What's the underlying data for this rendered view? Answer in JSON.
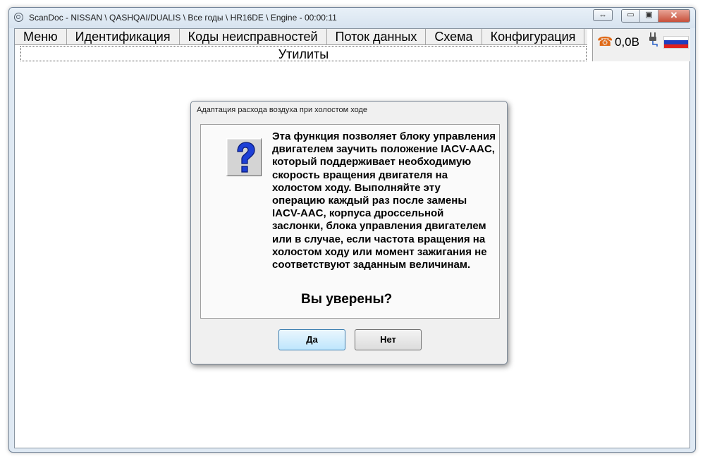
{
  "window": {
    "title": "ScanDoc - NISSAN \\ QASHQAI/DUALIS \\ Все годы \\ HR16DE \\ Engine - 00:00:11",
    "controls": {
      "swap": "⇔",
      "minimize": "▭",
      "restore": "▣",
      "close": "✕"
    }
  },
  "menu": {
    "items": [
      {
        "label": "Меню"
      },
      {
        "label": "Идентификация"
      },
      {
        "label": "Коды неисправностей"
      },
      {
        "label": "Поток данных"
      },
      {
        "label": "Схема"
      },
      {
        "label": "Конфигурация"
      }
    ],
    "utilities_label": "Утилиты"
  },
  "status": {
    "phone_glyph": "☎",
    "voltage": "0,0B",
    "phone_color": "#e06a18",
    "flag_colors": [
      "#ffffff",
      "#1f3fbf",
      "#e0211c"
    ]
  },
  "dialog": {
    "title": "Адаптация расхода воздуха при холостом ходе",
    "message": "Эта функция позволяет блоку управления двигателем заучить положение IACV-AAC, который поддерживает необходимую скорость вращения двигателя на холостом ходу. Выполняйте эту операцию каждый раз после замены IACV-AAC, корпуса дроссельной заслонки, блока управления двигателем или в случае, если частота вращения на холостом ходу или момент зажигания не соответствуют заданным величинам.",
    "confirm": "Вы уверены?",
    "yes_label": "Да",
    "no_label": "Нет",
    "icon": "question-icon"
  }
}
